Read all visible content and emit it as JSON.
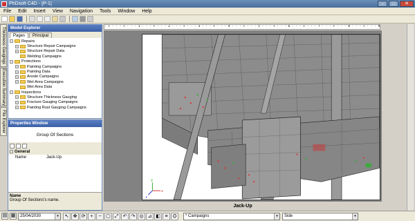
{
  "window": {
    "title": "PhDsoft C4D - [P-1]",
    "min_label": "–",
    "max_label": "□",
    "close_label": "✕"
  },
  "menu": [
    "File",
    "Edit",
    "Insert",
    "View",
    "Navigation",
    "Tools",
    "Window",
    "Help"
  ],
  "toolbar": {
    "icons": [
      "new-icon",
      "open-icon",
      "save-icon",
      "print-icon",
      "cut-icon",
      "copy-icon",
      "paste-icon",
      "edit-icon",
      "properties-icon",
      "layers-icon",
      "grid-icon"
    ]
  },
  "side_tabs": [
    "Thickness Gaugings",
    "Execution Summary",
    "File Explorer"
  ],
  "model_explorer": {
    "title": "Model Explorer",
    "tabs": [
      "Pages",
      "Principal"
    ],
    "tree": [
      {
        "label": "Repairs",
        "level": 0,
        "expander": "−"
      },
      {
        "label": "Structure Repair Campaigns",
        "level": 1,
        "expander": "+"
      },
      {
        "label": "Structure Repair Data",
        "level": 1,
        "expander": "+"
      },
      {
        "label": "Welding Campaigns",
        "level": 1,
        "expander": ""
      },
      {
        "label": "Protections",
        "level": 0,
        "expander": "−"
      },
      {
        "label": "Painting Campaigns",
        "level": 1,
        "expander": "+"
      },
      {
        "label": "Painting Data",
        "level": 1,
        "expander": "+"
      },
      {
        "label": "Anode Campaigns",
        "level": 1,
        "expander": "+"
      },
      {
        "label": "Wet Area Campaigns",
        "level": 1,
        "expander": "+"
      },
      {
        "label": "Wet Area Data",
        "level": 1,
        "expander": ""
      },
      {
        "label": "Inspections",
        "level": 0,
        "expander": "−"
      },
      {
        "label": "Structure Thickness Gauging",
        "level": 1,
        "expander": "+"
      },
      {
        "label": "Fracture Gauging Campaigns",
        "level": 1,
        "expander": "+"
      },
      {
        "label": "Painting Rust Gauging Campaigns",
        "level": 1,
        "expander": "+"
      }
    ]
  },
  "properties": {
    "title": "Properties Window",
    "object_title": "Group Of Sections",
    "section": "General",
    "rows": [
      {
        "key": "Name",
        "value": "Jack-Up"
      }
    ],
    "desc_title": "Name",
    "desc_text": "Group Of Sections's name."
  },
  "ruler": "· + · · · + · · · 1 · · · + · · · 2 · · · + · · · 3 · · · + · · · 4 · · · + · · · 5 · · · + · · · 6 · · · + · · · 7 · · · + · · · 8 · · · + · · · 9 · · · + · · · 10 · · · + · · · 11 · · · + · · · 12 · · · + · · · 13 · · · + · · · 14 · · · + · · · 15 · · · + · · · 16 · · · + · · · 17 · · · + · · · 18 · · · + · · · 19 · · · + · · · 20 · · · + · · · 21 · · · + · · · 22 · ·",
  "viewport": {
    "caption": "Jack-Up",
    "axis_x": "x",
    "axis_y": "y",
    "axis_z": "z"
  },
  "statusbar": {
    "date": "25/04/2030",
    "campaign_select": "* Campaigns",
    "view_select": "Side",
    "tools": [
      "select-icon",
      "pan-icon",
      "rotate-icon",
      "zoom-in-icon",
      "zoom-out-icon",
      "zoom-window-icon",
      "zoom-extents-icon",
      "undo-view-icon",
      "redo-view-icon",
      "fit-icon",
      "measure-icon",
      "section-icon",
      "layer-icon",
      "walk-icon"
    ]
  },
  "colors": {
    "panel_header": "#3a5fa4",
    "viewport_bg": "#828282",
    "structure_gray": "#8c8c8c",
    "marker_red": "#d23c3c",
    "marker_green": "#3caa3c"
  }
}
